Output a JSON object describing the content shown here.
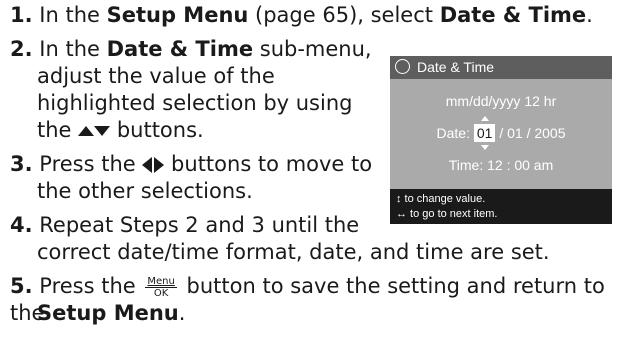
{
  "steps": [
    {
      "num": "1.",
      "t1": "In the ",
      "b1": "Setup Menu",
      "t2": " (page 65), select ",
      "b2": "Date & Time",
      "t3": "."
    },
    {
      "num": "2.",
      "t1": "In the ",
      "b1": "Date & Time",
      "t2": " sub-menu,",
      "l2": "adjust the value of the",
      "l3": "highlighted selection by using",
      "l4a": "the ",
      "l4b": " buttons."
    },
    {
      "num": "3.",
      "t1": "Press the ",
      "t2": " buttons to move to",
      "l2": "the other selections."
    },
    {
      "num": "4.",
      "t1": "Repeat Steps 2 and 3 until the",
      "l2": "correct date/time format, date, and time are set."
    },
    {
      "num": "5.",
      "t1": "Press the ",
      "t2": " button to save the setting and return to the",
      "b2": "Setup Menu",
      "t3": "."
    }
  ],
  "menu_ok": {
    "top": "Menu",
    "bottom": "OK"
  },
  "screen": {
    "title": "Date & Time",
    "format": "mm/dd/yyyy  12 hr",
    "date_label": "Date:",
    "date_month": "01",
    "date_rest": " / 01 / 2005",
    "time": "Time:  12 : 00  am",
    "hint1": "↕ to change value.",
    "hint2": "↔ to go to next item."
  },
  "colors": {
    "screen_bg": "#aaaaaa",
    "title_bar": "#5e5e5e",
    "footer": "#1a1a1a"
  }
}
